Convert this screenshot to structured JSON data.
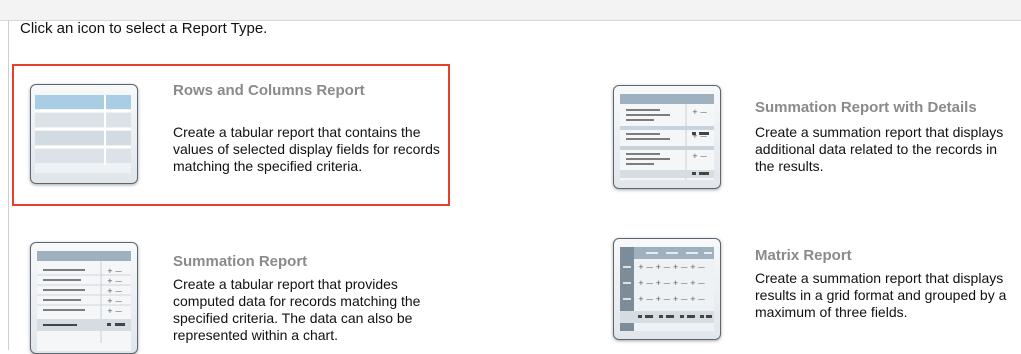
{
  "instruction": "Click an icon to select a Report Type.",
  "options": [
    {
      "title": "Rows and Columns Report",
      "description": "Create a tabular report that contains the values of selected display fields for records matching the specified criteria.",
      "icon": "rows-columns-report-icon",
      "selected": true
    },
    {
      "title": "Summation Report with Details",
      "description": "Create a summation report that displays additional data related to the records in the results.",
      "icon": "summation-details-report-icon",
      "selected": false
    },
    {
      "title": "Summation Report",
      "description": "Create a tabular report that provides computed data for records matching the specified criteria. The data can also be represented within a chart.",
      "icon": "summation-report-icon",
      "selected": false
    },
    {
      "title": "Matrix Report",
      "description": "Create a summation report that displays results in a grid format and grouped by a maximum of three fields.",
      "icon": "matrix-report-icon",
      "selected": false
    }
  ],
  "colors": {
    "selection": "#e8402a",
    "title": "#8a8a8a"
  }
}
